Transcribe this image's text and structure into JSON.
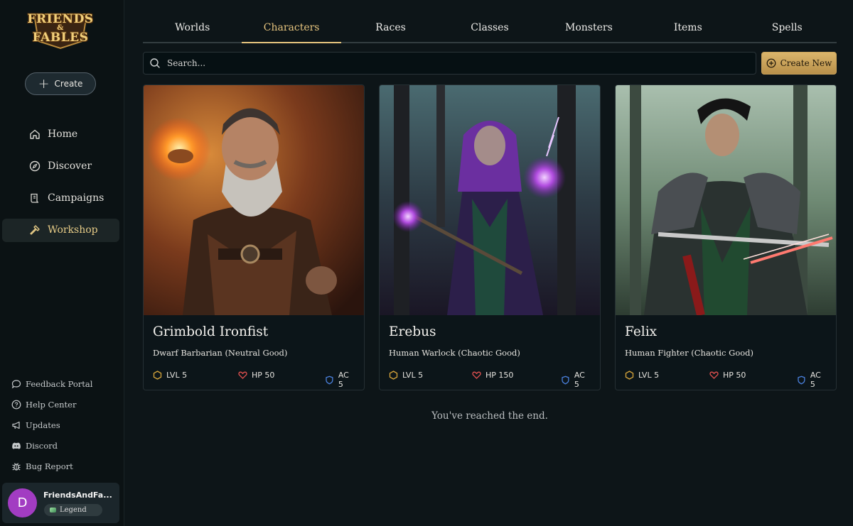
{
  "app": {
    "logo_lines": [
      "FRIENDS",
      "&",
      "FABLES"
    ],
    "create_label": "Create"
  },
  "sidebar": {
    "nav": [
      {
        "label": "Home",
        "icon": "home-icon",
        "active": false
      },
      {
        "label": "Discover",
        "icon": "compass-icon",
        "active": false
      },
      {
        "label": "Campaigns",
        "icon": "scroll-icon",
        "active": false
      },
      {
        "label": "Workshop",
        "icon": "hammer-icon",
        "active": true
      }
    ],
    "links": [
      {
        "label": "Feedback Portal",
        "icon": "chat-bubble-icon"
      },
      {
        "label": "Help Center",
        "icon": "help-circle-icon"
      },
      {
        "label": "Updates",
        "icon": "megaphone-icon"
      },
      {
        "label": "Discord",
        "icon": "discord-icon"
      },
      {
        "label": "Bug Report",
        "icon": "bug-icon"
      }
    ],
    "user": {
      "initial": "D",
      "name": "FriendsAndFa...",
      "badge": "Legend"
    }
  },
  "tabs": [
    {
      "label": "Worlds",
      "active": false
    },
    {
      "label": "Characters",
      "active": true
    },
    {
      "label": "Races",
      "active": false
    },
    {
      "label": "Classes",
      "active": false
    },
    {
      "label": "Monsters",
      "active": false
    },
    {
      "label": "Items",
      "active": false
    },
    {
      "label": "Spells",
      "active": false
    }
  ],
  "search": {
    "placeholder": "Search..."
  },
  "create_new_label": "Create New",
  "cards": [
    {
      "name": "Grimbold Ironfist",
      "subtitle": "Dwarf Barbarian (Neutral Good)",
      "lvl": "LVL 5",
      "hp": "HP 50",
      "ac": "AC 5",
      "portrait": "dwarf-barbarian-portrait"
    },
    {
      "name": "Erebus",
      "subtitle": "Human Warlock (Chaotic Good)",
      "lvl": "LVL 5",
      "hp": "HP 150",
      "ac": "AC 5",
      "portrait": "warlock-portrait"
    },
    {
      "name": "Felix",
      "subtitle": "Human Fighter (Chaotic Good)",
      "lvl": "LVL 5",
      "hp": "HP 50",
      "ac": "AC 5",
      "portrait": "fighter-portrait"
    }
  ],
  "end_message": "You've reached the end.",
  "colors": {
    "accent": "#e6c47e",
    "background": "#0d1518",
    "hp": "#e0504f",
    "ac": "#4b82e0",
    "lvl": "#d9a73b"
  }
}
